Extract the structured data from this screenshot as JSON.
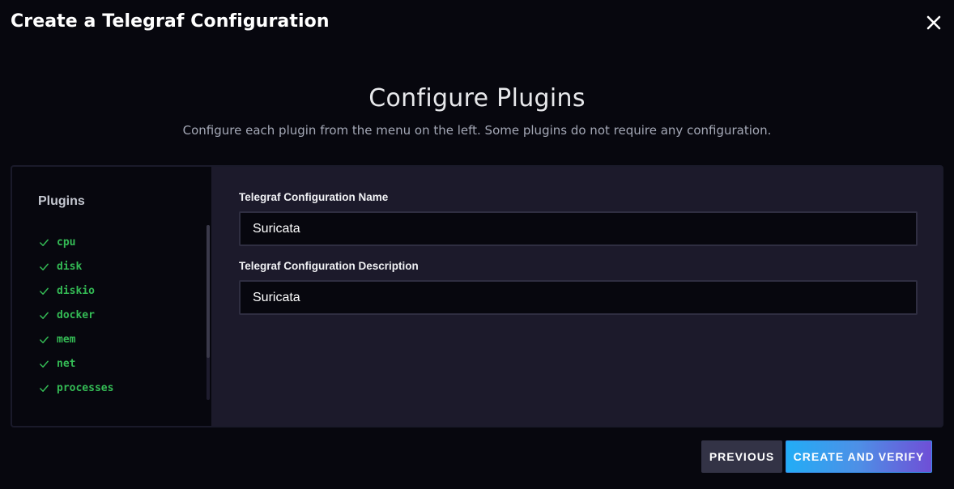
{
  "modal": {
    "title": "Create a Telegraf Configuration",
    "close_icon": "close-icon"
  },
  "step": {
    "heading": "Configure Plugins",
    "subheading": "Configure each plugin from the menu on the left. Some plugins do not require any configuration."
  },
  "sidebar": {
    "title": "Plugins",
    "items": [
      {
        "label": "cpu",
        "icon": "checkmark-icon"
      },
      {
        "label": "disk",
        "icon": "checkmark-icon"
      },
      {
        "label": "diskio",
        "icon": "checkmark-icon"
      },
      {
        "label": "docker",
        "icon": "checkmark-icon"
      },
      {
        "label": "mem",
        "icon": "checkmark-icon"
      },
      {
        "label": "net",
        "icon": "checkmark-icon"
      },
      {
        "label": "processes",
        "icon": "checkmark-icon"
      }
    ]
  },
  "form": {
    "name_label": "Telegraf Configuration Name",
    "name_value": "Suricata",
    "description_label": "Telegraf Configuration Description",
    "description_value": "Suricata"
  },
  "footer": {
    "previous_label": "PREVIOUS",
    "create_label": "CREATE AND VERIFY"
  },
  "colors": {
    "background": "#07070e",
    "panel": "#1c1a2b",
    "success": "#34bb55",
    "primary_gradient_start": "#22adf6",
    "primary_gradient_end": "#6f4fd6"
  }
}
